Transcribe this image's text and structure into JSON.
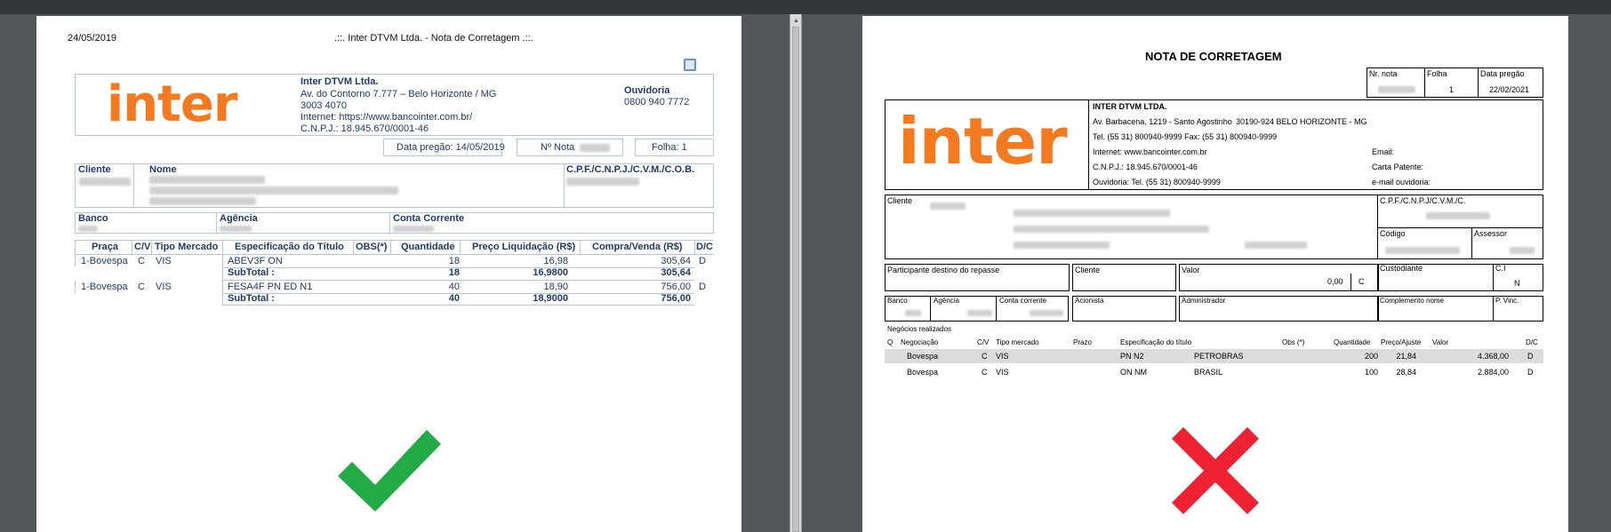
{
  "left": {
    "print_date": "24/05/2019",
    "print_title": ".::. Inter DTVM Ltda. - Nota de Corretagem .::.",
    "logo_text": "inter",
    "company": {
      "name": "Inter DTVM Ltda.",
      "address": "Av. do Contorno 7.777 – Belo Horizonte / MG",
      "phone": "3003 4070",
      "internet": "Internet:  https://www.bancointer.com.br/",
      "cnpj": "C.N.P.J.: 18.945.670/0001-46"
    },
    "ouvidoria": {
      "label": "Ouvidoria",
      "phone": "0800 940 7772"
    },
    "data_pregao": "Data pregão: 14/05/2019",
    "nota_label": "Nº Nota",
    "folha": "Folha: 1",
    "client_labels": {
      "cliente": "Cliente",
      "nome": "Nome",
      "cpf": "C.P.F./C.N.P.J./C.V.M./C.O.B."
    },
    "bank_labels": {
      "banco": "Banco",
      "agencia": "Agência",
      "conta": "Conta Corrente"
    },
    "table": {
      "headers": [
        "Praça",
        "C/V",
        "Tipo Mercado",
        "Especificação do Título",
        "OBS(*)",
        "Quantidade",
        "Preço Liquidação (R$)",
        "Compra/Venda (R$)",
        "D/C"
      ],
      "rows": [
        {
          "praca": "1-Bovespa",
          "cv": "C",
          "tipo": "VIS",
          "titulo": "ABEV3F ON",
          "qtd": "18",
          "preco": "16,98",
          "valor": "305,64",
          "dc": "D",
          "subtotal_label": "SubTotal :",
          "subtotal_qtd": "18",
          "subtotal_preco": "16,9800",
          "subtotal_valor": "305,64"
        },
        {
          "praca": "1-Bovespa",
          "cv": "C",
          "tipo": "VIS",
          "titulo": "FESA4F PN ED N1",
          "qtd": "40",
          "preco": "18,90",
          "valor": "756,00",
          "dc": "D",
          "subtotal_label": "SubTotal :",
          "subtotal_qtd": "40",
          "subtotal_preco": "18,9000",
          "subtotal_valor": "756,00"
        }
      ]
    }
  },
  "right": {
    "title": "NOTA DE CORRETAGEM",
    "nota_labels": {
      "nr": "Nr. nota",
      "folha": "Folha",
      "data": "Data pregão"
    },
    "folha_value": "1",
    "data_value": "22/02/2021",
    "logo_text": "inter",
    "company": {
      "name": "INTER DTVM LTDA.",
      "address": "Av. Barbacena, 1219 - Santo Agostinho",
      "city": "30190-924 BELO HORIZONTE - MG",
      "phone": "Tel. (55 31) 800940-9999  Fax: (55 31) 800940-9999",
      "internet": "Internet: www.bancointer.com.br",
      "cnpj": "C.N.P.J.: 18.945.670/0001-46",
      "ouvidoria": "Ouvidoria: Tel. (55 31) 800940-9999",
      "email": "Email:",
      "carta": "Carta Patente:",
      "email_ouvidoria": "e-mail ouvidoria:"
    },
    "labels": {
      "cliente": "Cliente",
      "cpf": "C.P.F./C.N.P.J/C.V.M./C.",
      "codigo": "Código",
      "assessor": "Assessor",
      "participante": "Participante destino do repasse",
      "cliente2": "Cliente",
      "valor": "Valor",
      "custodiante": "Custodiante",
      "ci": "C.I",
      "banco": "Banco",
      "agencia": "Agência",
      "conta": "Conta corrente",
      "acionista": "Acionista",
      "administrador": "Administrador",
      "complemento": "Complemento nome",
      "pvinc": "P. Vinc.",
      "negocios": "Negócios realizados"
    },
    "valor_value": "0,00",
    "valor_flag": "C",
    "ci_value": "N",
    "table": {
      "headers": [
        "Q",
        "Negociação",
        "C/V",
        "Tipo mercado",
        "Prazo",
        "Especificação do título",
        "Obs (*)",
        "Quantidade",
        "Preço/Ajuste",
        "Valor",
        "D/C"
      ],
      "rows": [
        {
          "neg": "Bovespa",
          "cv": "C",
          "tipo": "VIS",
          "esp": "PN N2",
          "titulo": "PETROBRAS",
          "qtd": "200",
          "preco": "21,84",
          "valor": "4.368,00",
          "dc": "D"
        },
        {
          "neg": "Bovespa",
          "cv": "C",
          "tipo": "VIS",
          "esp": "ON NM",
          "titulo": "BRASIL",
          "qtd": "100",
          "preco": "28,84",
          "valor": "2.884,00",
          "dc": "D"
        }
      ]
    }
  },
  "colors": {
    "check": "#22aa44",
    "cross": "#ee2233",
    "brand": "#f47a20",
    "navy": "#1f3a6b"
  }
}
